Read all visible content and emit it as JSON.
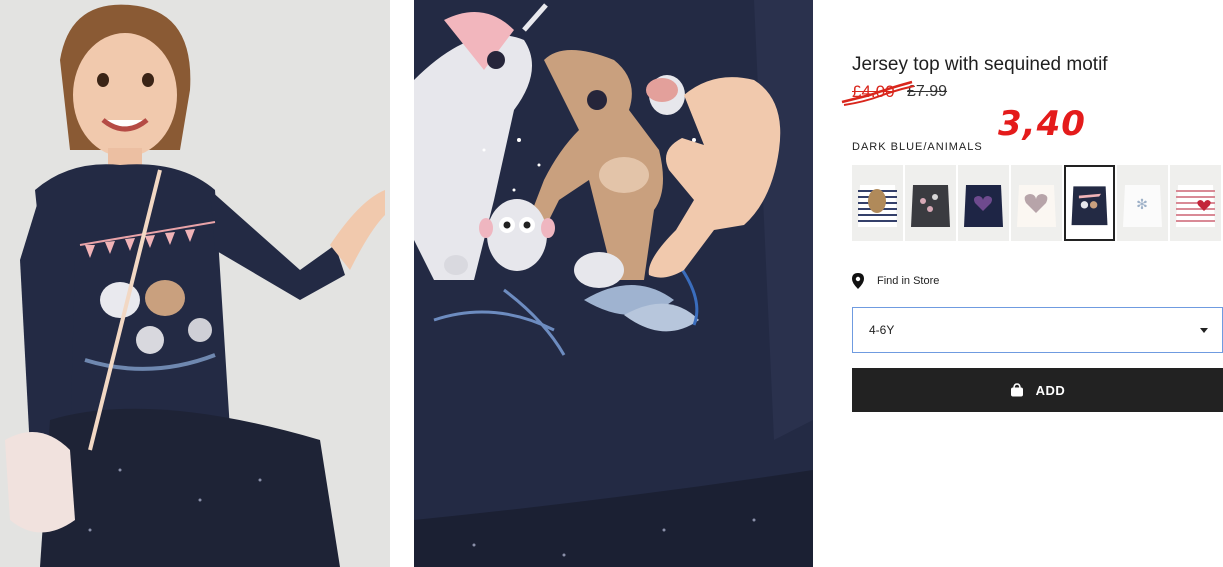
{
  "product": {
    "title": "Jersey top with sequined motif",
    "sale_price": "£4.00",
    "original_price": "£7.99",
    "handwritten_new_price": "3,40",
    "color_label": "DARK BLUE/ANIMALS"
  },
  "swatches": [
    {
      "name": "striped sequin dog top",
      "selected": false
    },
    {
      "name": "dark grey sequin top",
      "selected": false
    },
    {
      "name": "navy heart top",
      "selected": false
    },
    {
      "name": "white heart top",
      "selected": false
    },
    {
      "name": "dark blue animals top",
      "selected": true
    },
    {
      "name": "white snowflake top",
      "selected": false
    },
    {
      "name": "red striped heart top",
      "selected": false
    }
  ],
  "store": {
    "find_label": "Find in Store"
  },
  "size_select": {
    "value": "4-6Y"
  },
  "add_button": {
    "label": "ADD"
  },
  "colors": {
    "sale_red": "#d9261c",
    "annotation_red": "#e41b1b",
    "button_dark": "#222222",
    "select_border": "#6f9be0",
    "shirt_navy": "#232a44"
  },
  "icons": [
    "location-pin-icon",
    "shopping-bag-icon",
    "chevron-down-icon"
  ]
}
